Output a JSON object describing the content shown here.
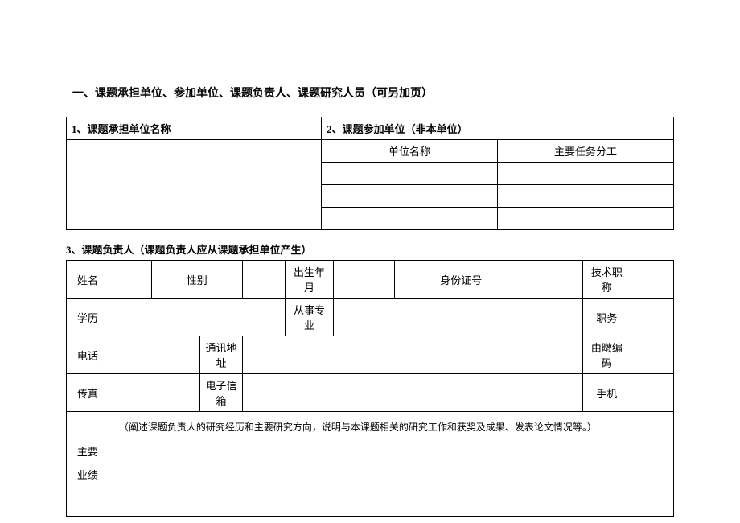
{
  "title": "一、课题承担单位、参加单位、课题负责人、课题研究人员（可另加页）",
  "section1": {
    "label": "1、课题承担单位名称"
  },
  "section2": {
    "label": "2、课题参加单位（非本单位）",
    "col_unit": "单位名称",
    "col_task": "主要任务分工"
  },
  "section3": {
    "label": "3、课题负责人（课题负责人应从课题承担单位产生）",
    "fields": {
      "name": "姓名",
      "gender": "性别",
      "birth": "出生年月",
      "idno": "身份证号",
      "techtitle": "技术职称",
      "education": "学历",
      "major": "从事专业",
      "position": "职务",
      "phone": "电话",
      "address": "通讯地址",
      "postcode": "由暾编码",
      "fax": "传真",
      "email": "电子信箱",
      "mobile": "手机",
      "mainperf": "主要\n业绩",
      "achievements_hint": "（阐述课题负责人的研究经历和主要研究方向，说明与本课题相关的研究工作和获奖及成果、发表论文情况等。）"
    }
  }
}
